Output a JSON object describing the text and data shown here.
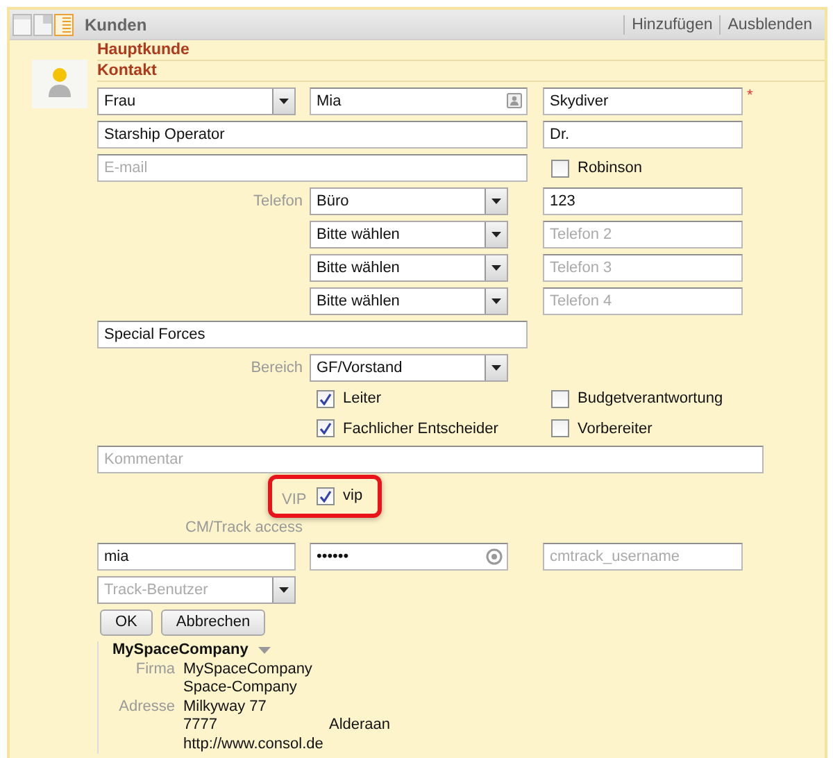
{
  "header": {
    "title": "Kunden",
    "actions": [
      "Hinzufügen",
      "Ausblenden"
    ]
  },
  "sections": [
    "Hauptkunde",
    "Kontakt"
  ],
  "contact": {
    "salutation": "Frau",
    "first_name": "Mia",
    "last_name": "Skydiver",
    "required_mark": "*",
    "position": "Starship Operator",
    "title": "Dr.",
    "email": {
      "placeholder": "E-mail"
    },
    "robinson": {
      "label": "Robinson",
      "checked": false
    },
    "phone_label": "Telefon",
    "phones": [
      {
        "type": "Büro",
        "value": "123"
      },
      {
        "type": "Bitte wählen",
        "placeholder": "Telefon 2"
      },
      {
        "type": "Bitte wählen",
        "placeholder": "Telefon 3"
      },
      {
        "type": "Bitte wählen",
        "placeholder": "Telefon 4"
      }
    ],
    "department": "Special Forces",
    "area_label": "Bereich",
    "area": "GF/Vorstand",
    "roles": [
      {
        "label": "Leiter",
        "checked": true
      },
      {
        "label": "Budgetverantwortung",
        "checked": false
      },
      {
        "label": "Fachlicher Entscheider",
        "checked": true
      },
      {
        "label": "Vorbereiter",
        "checked": false
      }
    ],
    "comment": {
      "placeholder": "Kommentar"
    },
    "vip": {
      "label": "VIP",
      "option": "vip",
      "checked": true
    },
    "access": {
      "label": "CM/Track access",
      "username": "mia",
      "password": "••••••",
      "cmtrack": {
        "placeholder": "cmtrack_username"
      },
      "user_type": {
        "placeholder": "Track-Benutzer"
      }
    },
    "buttons": [
      "OK",
      "Abbrechen"
    ]
  },
  "company": {
    "name": "MySpaceCompany",
    "fields": [
      {
        "label": "Firma",
        "lines": [
          [
            "MySpaceCompany"
          ],
          [
            "Space-Company"
          ]
        ]
      },
      {
        "label": "Adresse",
        "lines": [
          [
            "Milkyway 77"
          ],
          [
            "7777",
            "Alderaan"
          ],
          [
            "http://www.consol.de"
          ]
        ]
      }
    ]
  }
}
